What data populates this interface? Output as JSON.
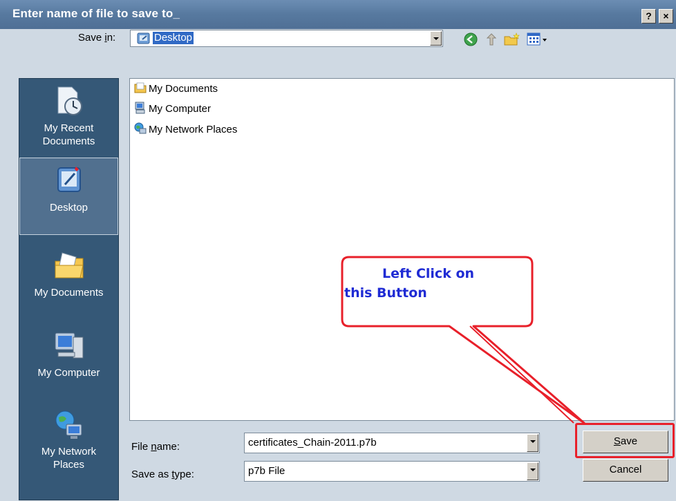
{
  "window": {
    "title": "Enter name of file to save to_",
    "help_label": "?",
    "close_label": "×"
  },
  "toolbar": {
    "save_in_label": "Save in:",
    "save_in_value": "Desktop"
  },
  "places": [
    {
      "label": "My Recent\nDocuments",
      "icon": "recent-documents-icon"
    },
    {
      "label": "Desktop",
      "icon": "desktop-icon"
    },
    {
      "label": "My Documents",
      "icon": "my-documents-icon"
    },
    {
      "label": "My Computer",
      "icon": "my-computer-icon"
    },
    {
      "label": "My Network\nPlaces",
      "icon": "network-places-icon"
    }
  ],
  "files": [
    {
      "label": "My Documents",
      "icon": "folder-icon"
    },
    {
      "label": "My Computer",
      "icon": "computer-icon"
    },
    {
      "label": "My Network Places",
      "icon": "network-icon"
    }
  ],
  "form": {
    "file_name_label": "File name:",
    "file_name_value": "certificates_Chain-2011.p7b",
    "save_as_type_label": "Save as type:",
    "save_as_type_value": "p7b File"
  },
  "buttons": {
    "save_label": "Save",
    "cancel_label": "Cancel"
  },
  "annotation": {
    "line1": "Left Click on",
    "line2": "this Button",
    "color": "#e8202a",
    "text_color": "#1f2bd4"
  }
}
